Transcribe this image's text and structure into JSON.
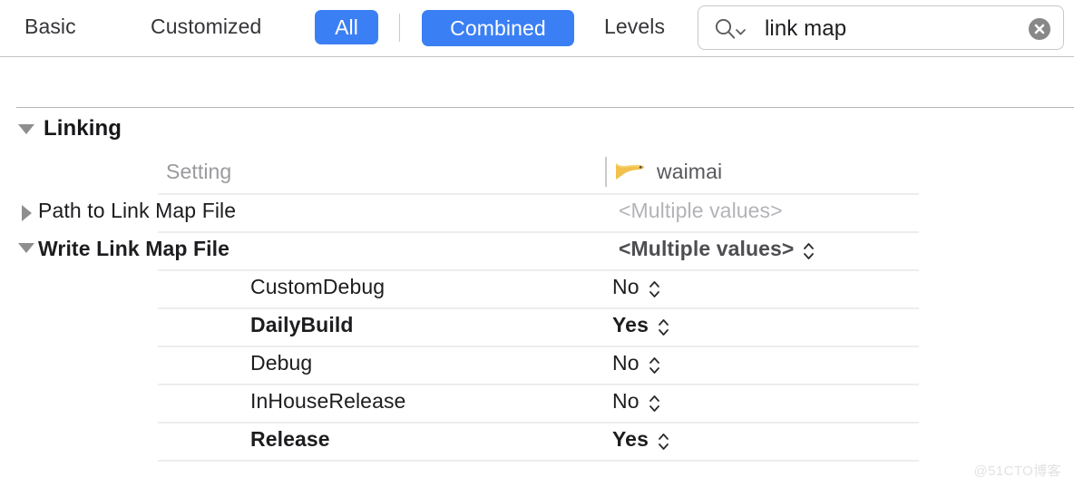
{
  "toolbar": {
    "segments": [
      {
        "label": "Basic",
        "selected": false
      },
      {
        "label": "Customized",
        "selected": false
      },
      {
        "label": "All",
        "selected": true
      },
      {
        "label": "Combined",
        "selected": true
      },
      {
        "label": "Levels",
        "selected": false
      }
    ],
    "accent_color": "#3b7ff5",
    "search": {
      "icon": "search-icon",
      "dropdown_icon": "chevron-down-icon",
      "value": "link map",
      "placeholder": "Search",
      "clear_icon": "clear-circle-icon"
    }
  },
  "group": {
    "disclosure": "triangle-down-icon",
    "title": "Linking",
    "expanded": true
  },
  "columns": {
    "setting": "Setting",
    "target": {
      "icon": "xcode-target-icon",
      "name": "waimai"
    }
  },
  "rows": [
    {
      "kind": "setting",
      "disclosure": "triangle-right-icon",
      "expanded": false,
      "label": "Path to Link Map File",
      "bold_label": false,
      "value": "<Multiple values>",
      "value_style": "muted",
      "has_stepper": false
    },
    {
      "kind": "setting",
      "disclosure": "triangle-down-icon",
      "expanded": true,
      "label": "Write Link Map File",
      "bold_label": true,
      "value": "<Multiple values>",
      "value_style": "strong",
      "has_stepper": true
    },
    {
      "kind": "config",
      "label": "CustomDebug",
      "bold_label": false,
      "value": "No",
      "value_style": "plain",
      "has_stepper": true
    },
    {
      "kind": "config",
      "label": "DailyBuild",
      "bold_label": true,
      "value": "Yes",
      "value_style": "plain",
      "has_stepper": true
    },
    {
      "kind": "config",
      "label": "Debug",
      "bold_label": false,
      "value": "No",
      "value_style": "plain",
      "has_stepper": true
    },
    {
      "kind": "config",
      "label": "InHouseRelease",
      "bold_label": false,
      "value": "No",
      "value_style": "plain",
      "has_stepper": true
    },
    {
      "kind": "config",
      "label": "Release",
      "bold_label": true,
      "value": "Yes",
      "value_style": "plain",
      "has_stepper": true
    }
  ],
  "watermark": "@51CTO博客"
}
